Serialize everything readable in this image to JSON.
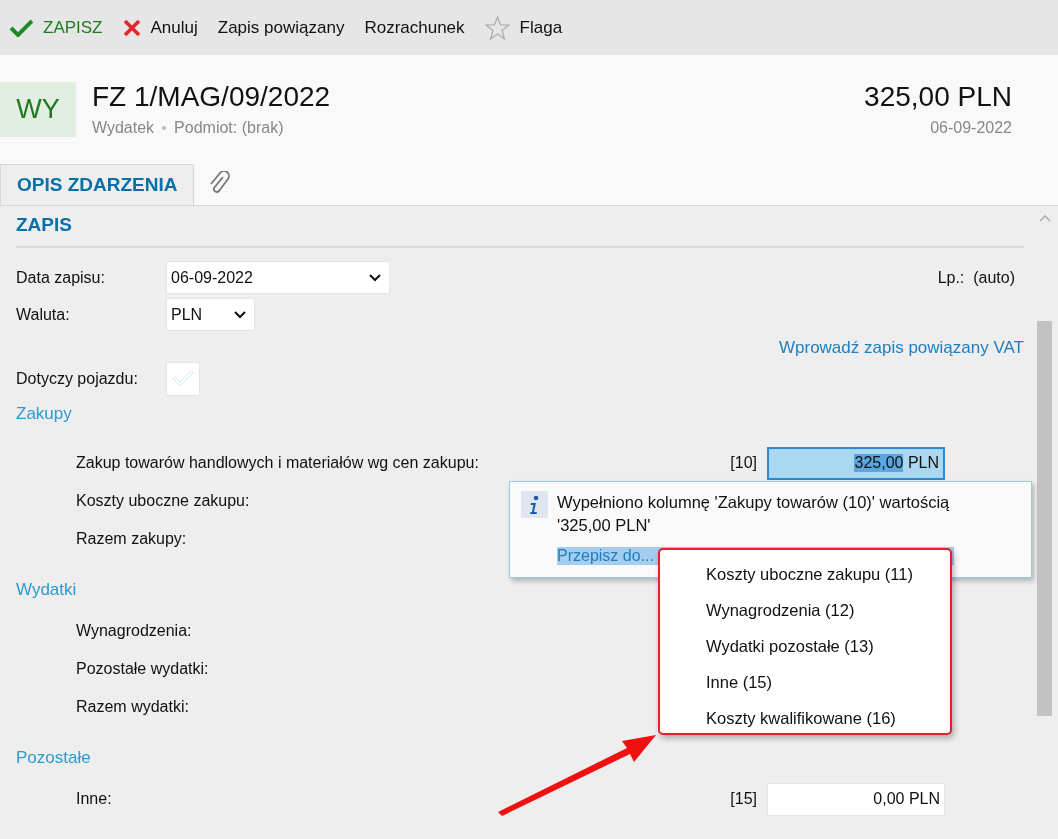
{
  "toolbar": [
    {
      "kind": "save",
      "label": "ZAPISZ"
    },
    {
      "kind": "cancel",
      "label": "Anuluj"
    },
    {
      "kind": "plain",
      "label": "Zapis powiązany"
    },
    {
      "kind": "plain",
      "label": "Rozrachunek"
    },
    {
      "kind": "flag",
      "label": "Flaga"
    }
  ],
  "header": {
    "badge": "WY",
    "title": "FZ 1/MAG/09/2022",
    "subtitle": [
      "Wydatek",
      "Podmiot: (brak)"
    ],
    "amount": "325,00 PLN",
    "date": "06-09-2022"
  },
  "tabs": [
    {
      "kind": "text",
      "label": "OPIS ZDARZENIA",
      "selected": true
    },
    {
      "kind": "attachment",
      "selected": false
    }
  ],
  "section": {
    "title": "ZAPIS",
    "fields": [
      {
        "kind": "select",
        "label": "Data zapisu:",
        "value": "06-09-2022",
        "wide": true
      },
      {
        "kind": "select",
        "label": "Waluta:",
        "value": "PLN",
        "wide": false
      }
    ],
    "number": {
      "label": "Lp.:",
      "value": "(auto)"
    },
    "link": "Wprowadź zapis powiązany VAT",
    "checkbox": {
      "label": "Dotyczy pojazdu:",
      "checked": false
    },
    "groups": [
      {
        "title": "Zakupy",
        "rows": [
          {
            "label": "Zakup towarów handlowych i materiałów wg cen zakupu:",
            "code": "[10]",
            "amount": "325,00",
            "currency": "PLN",
            "focused": true
          },
          {
            "label": "Koszty uboczne zakupu:"
          },
          {
            "label": "Razem zakupy:"
          }
        ]
      },
      {
        "title": "Wydatki",
        "rows": [
          {
            "label": "Wynagrodzenia:"
          },
          {
            "label": "Pozostałe wydatki:"
          },
          {
            "label": "Razem wydatki:"
          }
        ]
      },
      {
        "title": "Pozostałe",
        "rows": [
          {
            "label": "Inne:",
            "code": "[15]",
            "amount": "0,00",
            "currency": "PLN",
            "focused": false
          }
        ]
      }
    ]
  },
  "popup": {
    "message": "Wypełniono kolumnę 'Zakupy towarów (10)' wartością '325,00 PLN'",
    "link": "Przepisz do..."
  },
  "menu": [
    "Koszty uboczne zakupu (11)",
    "Wynagrodzenia (12)",
    "Wydatki pozostałe (13)",
    "Inne (15)",
    "Koszty kwalifikowane (16)"
  ]
}
